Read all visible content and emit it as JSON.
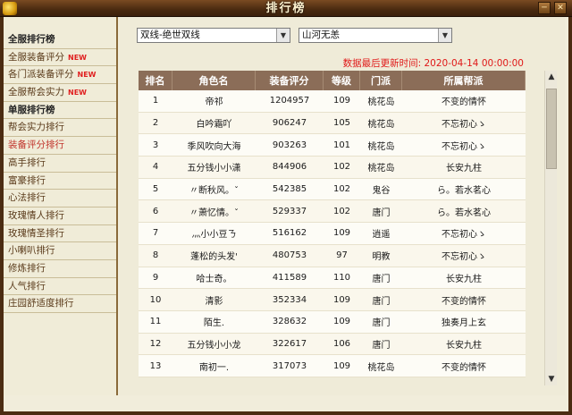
{
  "window": {
    "title": "排行榜"
  },
  "sidebar": {
    "items": [
      {
        "label": "全服排行榜",
        "type": "header",
        "new": ""
      },
      {
        "label": "全服装备评分",
        "type": "item",
        "new": "NEW"
      },
      {
        "label": "各门派装备评分",
        "type": "item",
        "new": "NEW"
      },
      {
        "label": "全服帮会实力",
        "type": "item",
        "new": "NEW"
      },
      {
        "label": "单服排行榜",
        "type": "header",
        "new": ""
      },
      {
        "label": "帮会实力排行",
        "type": "item",
        "new": ""
      },
      {
        "label": "装备评分排行",
        "type": "active",
        "new": ""
      },
      {
        "label": "高手排行",
        "type": "item",
        "new": ""
      },
      {
        "label": "富豪排行",
        "type": "item",
        "new": ""
      },
      {
        "label": "心法排行",
        "type": "item",
        "new": ""
      },
      {
        "label": "玫瑰情人排行",
        "type": "item",
        "new": ""
      },
      {
        "label": "玫瑰情圣排行",
        "type": "item",
        "new": ""
      },
      {
        "label": "小喇叭排行",
        "type": "item",
        "new": ""
      },
      {
        "label": "修炼排行",
        "type": "item",
        "new": ""
      },
      {
        "label": "人气排行",
        "type": "item",
        "new": ""
      },
      {
        "label": "庄园舒适度排行",
        "type": "item",
        "new": ""
      }
    ]
  },
  "filters": {
    "server": "双线-绝世双线",
    "sub_server": "山河无恙"
  },
  "update_text": "数据最后更新时间: 2020-04-14 00:00:00",
  "table": {
    "columns": [
      "排名",
      "角色名",
      "装备评分",
      "等级",
      "门派",
      "所属帮派"
    ],
    "rows": [
      [
        "1",
        "帝祁",
        "1204957",
        "109",
        "桃花岛",
        "不变的情怀"
      ],
      [
        "2",
        "白吟霜吖",
        "906247",
        "105",
        "桃花岛",
        "不忘初心ゝ"
      ],
      [
        "3",
        "季风吹向大海",
        "903263",
        "101",
        "桃花岛",
        "不忘初心ゝ"
      ],
      [
        "4",
        "五分钱小小潇",
        "844906",
        "102",
        "桃花岛",
        "长安九柱"
      ],
      [
        "5",
        "〃断秋风。ˇ",
        "542385",
        "102",
        "鬼谷",
        "ら。若水茗心"
      ],
      [
        "6",
        "〃萧忆情。ˇ",
        "529337",
        "102",
        "唐门",
        "ら。若水茗心"
      ],
      [
        "7",
        "灬小小豆ㄋ",
        "516162",
        "109",
        "逍遥",
        "不忘初心ゝ"
      ],
      [
        "8",
        "蓬松的头发'",
        "480753",
        "97",
        "明教",
        "不忘初心ゝ"
      ],
      [
        "9",
        "哈士奇。",
        "411589",
        "110",
        "唐门",
        "长安九柱"
      ],
      [
        "10",
        "清影",
        "352334",
        "109",
        "唐门",
        "不变的情怀"
      ],
      [
        "11",
        "陌生.",
        "328632",
        "109",
        "唐门",
        "独奏月上玄"
      ],
      [
        "12",
        "五分钱小小龙",
        "322617",
        "106",
        "唐门",
        "长安九柱"
      ],
      [
        "13",
        "南初一.",
        "317073",
        "109",
        "桃花岛",
        "不变的情怀"
      ]
    ]
  },
  "icons": {
    "minimize": "minimize-icon",
    "close": "close-icon",
    "dropdown": "chevron-down-icon"
  },
  "colors": {
    "accent": "#c0322a",
    "header_bg": "#8b6d58",
    "update_text": "#e01818",
    "new_badge": "#e02020"
  }
}
